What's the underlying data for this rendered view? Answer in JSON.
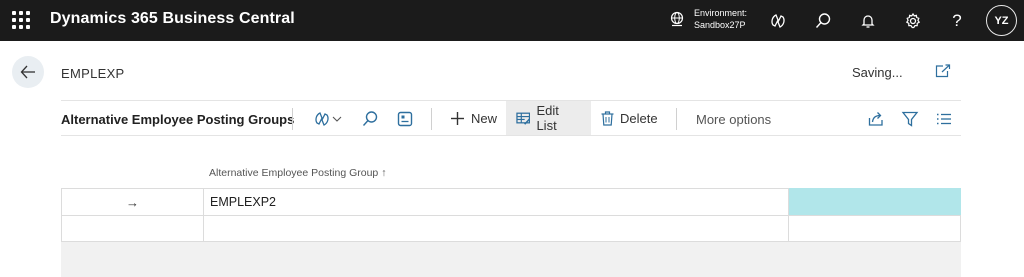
{
  "topbar": {
    "app_title": "Dynamics 365 Business Central",
    "environment_label": "Environment:",
    "environment_name": "Sandbox27P",
    "avatar_initials": "YZ",
    "help_label": "?",
    "icons": [
      "app-launcher-icon",
      "globe-icon",
      "copilot-icon",
      "search-icon",
      "bell-icon",
      "gear-icon",
      "help-icon"
    ]
  },
  "header": {
    "caption": "EMPLEXP",
    "status": "Saving..."
  },
  "actionbar": {
    "title": "Alternative Employee Posting Groups",
    "new_label": "New",
    "edit_list_label": "Edit List",
    "delete_label": "Delete",
    "more_options_label": "More options"
  },
  "grid": {
    "column_header": "Alternative Employee Posting Group",
    "sort_indicator": "↑",
    "rows": [
      {
        "indicator": "→",
        "value": "EMPLEXP2"
      },
      {
        "indicator": "",
        "value": ""
      }
    ]
  },
  "colors": {
    "topbar_bg": "#1b1b1b",
    "selected_cell": "#b1e6ea",
    "active_button": "#ececec"
  }
}
